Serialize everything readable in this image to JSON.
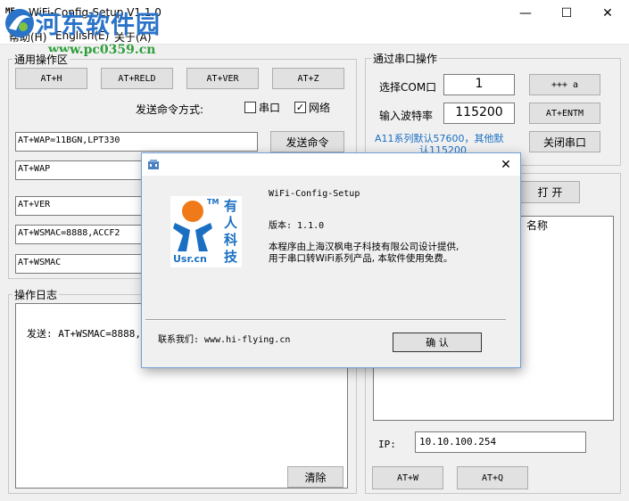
{
  "window": {
    "title": "WiFi-Config-Setup V1.1.0",
    "app_icon_text": "ME",
    "minimize": "—",
    "maximize": "☐",
    "close": "✕"
  },
  "watermark": {
    "cn": "河东软件园",
    "url": "www.pc0359.cn"
  },
  "menu": [
    "帮助(H)",
    "English(E)",
    "关于(A)"
  ],
  "general": {
    "label": "通用操作区",
    "buttons": [
      "AT+H",
      "AT+RELD",
      "AT+VER",
      "AT+Z"
    ],
    "send_mode_label": "发送命令方式:",
    "serial_label": "串口",
    "network_label": "网络",
    "serial_checked": "",
    "network_checked": "✓",
    "commands": [
      "AT+WAP=11BGN,LPT330",
      "AT+WAP",
      "AT+VER",
      "AT+WSMAC=8888,ACCF2",
      "AT+WSMAC"
    ],
    "send_button": "发送命令"
  },
  "serial": {
    "label": "通过串口操作",
    "com_label": "选择COM口",
    "com_value": "1",
    "baud_label": "输入波特率",
    "baud_value": "115200",
    "plus_button": "+++ a",
    "entm_button": "AT+ENTM",
    "close_button": "关闭串口",
    "note_line1": "A11系列默认57600，其他默",
    "note_line2": "认115200"
  },
  "network": {
    "open_button": "打 开",
    "list_header": "名称",
    "ip_label": "IP:",
    "ip_value": "10.10.100.254",
    "atw_button": "AT+W",
    "atq_button": "AT+Q"
  },
  "log": {
    "label": "操作日志",
    "line": "发送: AT+WSMAC=8888,A",
    "clear_button": "清除"
  },
  "about_dialog": {
    "close": "✕",
    "product": "WiFi-Config-Setup",
    "version": "版本: 1.1.0",
    "desc_line1": "本程序由上海汉枫电子科技有限公司设计提供,",
    "desc_line2": "用于串口转WiFi系列产品, 本软件使用免费。",
    "contact": "联系我们: www.hi-flying.cn",
    "ok_button": "确 认",
    "logo": {
      "tm": "TM",
      "brand": "Usr.cn",
      "chars": [
        "有",
        "人",
        "科",
        "技"
      ]
    }
  },
  "colors": {
    "accent_blue": "#2a73c8",
    "watermark_green": "#2e9e3a",
    "logo_orange": "#f07a1a",
    "logo_blue": "#1b6fc2",
    "note_blue": "#1a6fc4"
  }
}
